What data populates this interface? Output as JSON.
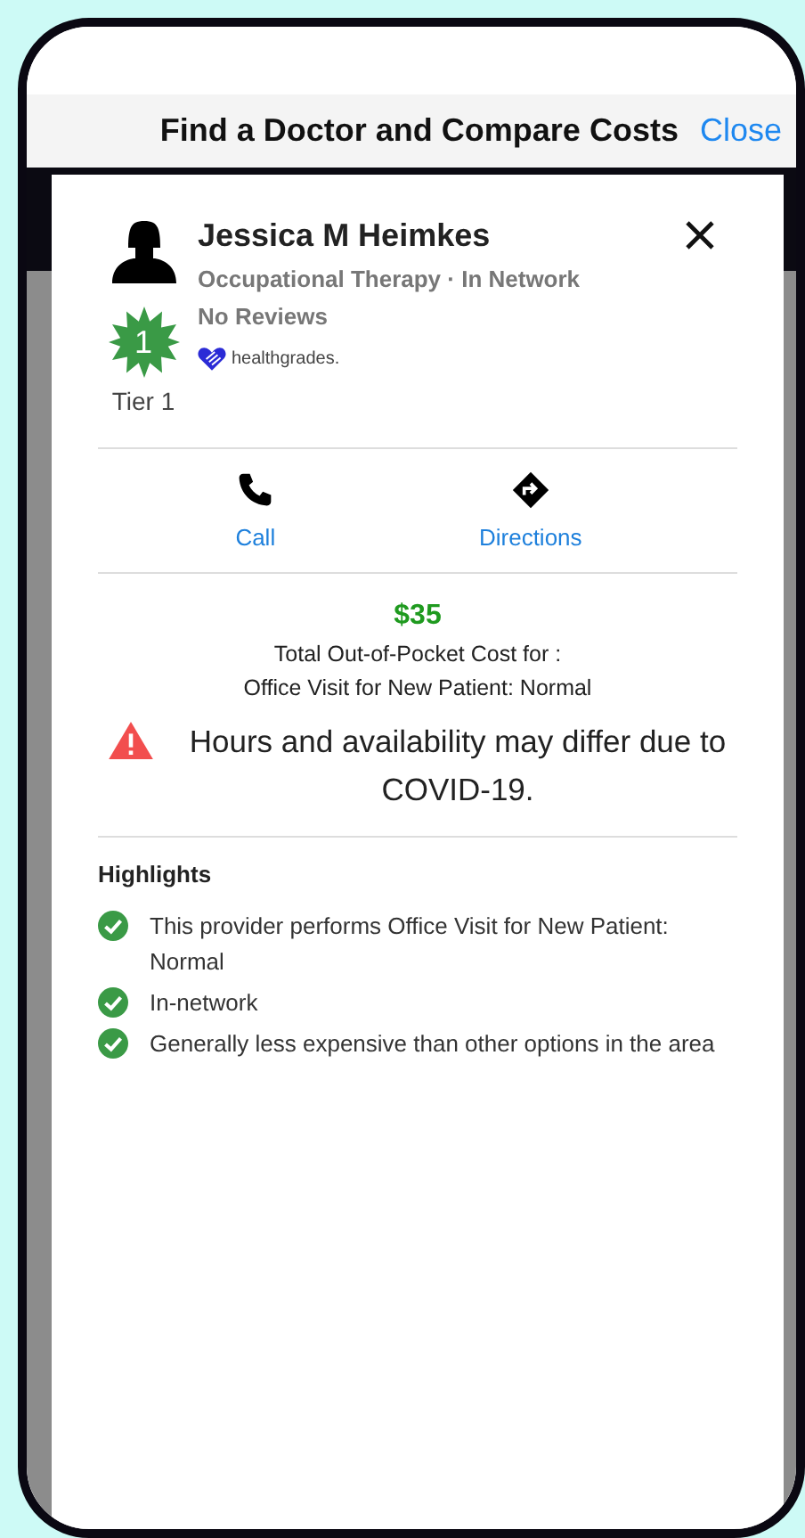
{
  "header": {
    "title": "Find a Doctor and Compare Costs",
    "close": "Close"
  },
  "provider": {
    "name": "Jessica M Heimkes",
    "specialty": "Occupational Therapy · In Network",
    "reviews": "No Reviews",
    "tier_number": "1",
    "tier_label": "Tier 1",
    "source": "healthgrades."
  },
  "actions": [
    {
      "kind": "call",
      "label": "Call"
    },
    {
      "kind": "directions",
      "label": "Directions"
    }
  ],
  "cost": {
    "amount": "$35",
    "label": "Total Out-of-Pocket Cost for :",
    "service": "Office Visit for New Patient: Normal"
  },
  "notice": "Hours and availability may differ due to COVID-19.",
  "highlights": {
    "title": "Highlights",
    "items": [
      "This provider performs Office Visit for New Patient: Normal",
      "In-network",
      "Generally less expensive than other options in the area"
    ]
  }
}
